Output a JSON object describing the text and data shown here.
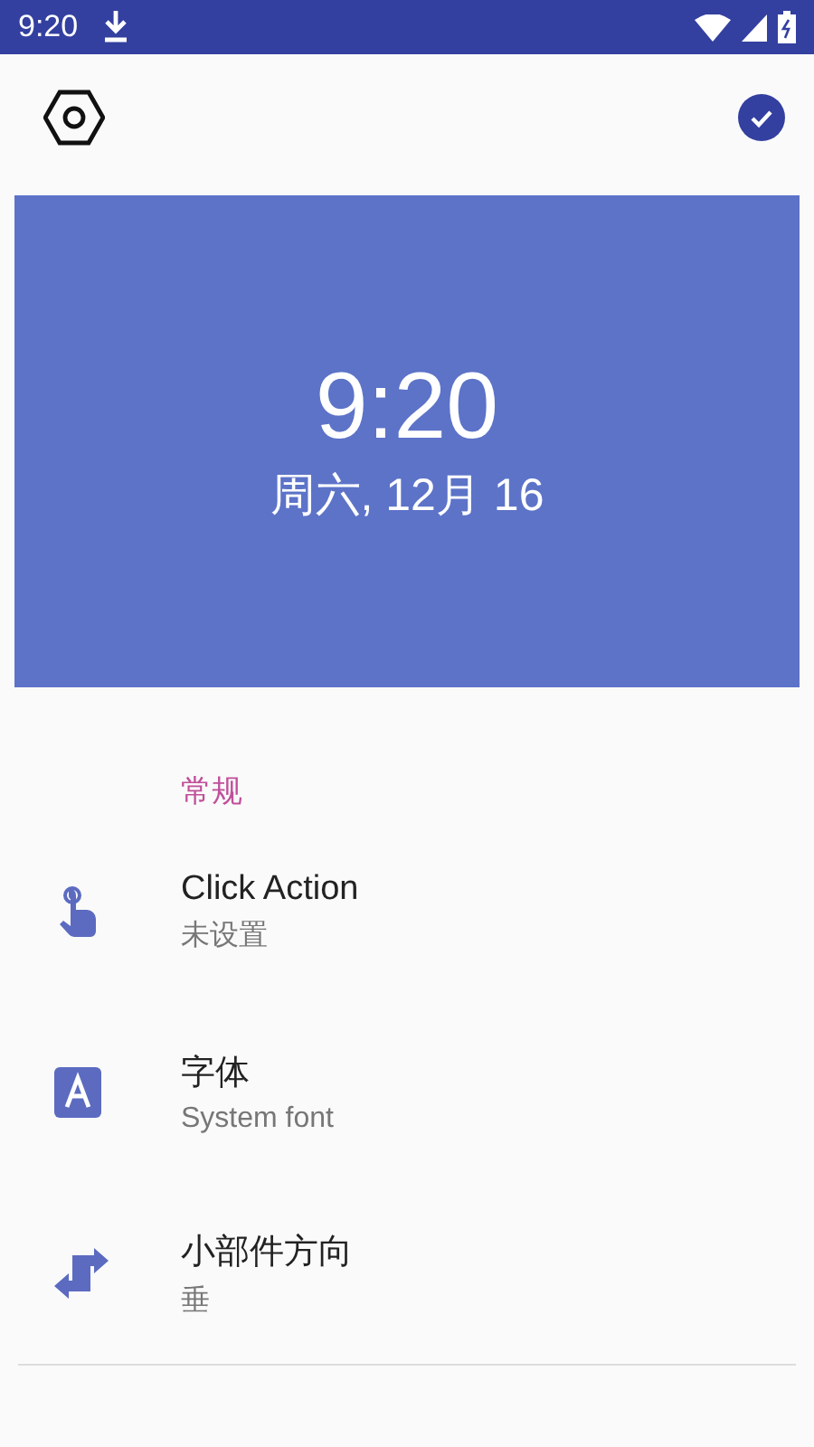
{
  "status_bar": {
    "time": "9:20"
  },
  "preview": {
    "time": "9:20",
    "date": "周六, 12月 16"
  },
  "section": {
    "title": "常规"
  },
  "items": [
    {
      "kind": "touch",
      "title": "Click Action",
      "subtitle": "未设置"
    },
    {
      "kind": "font",
      "title": "字体",
      "subtitle": "System font"
    },
    {
      "kind": "swap",
      "title": "小部件方向",
      "subtitle": "垂"
    }
  ]
}
